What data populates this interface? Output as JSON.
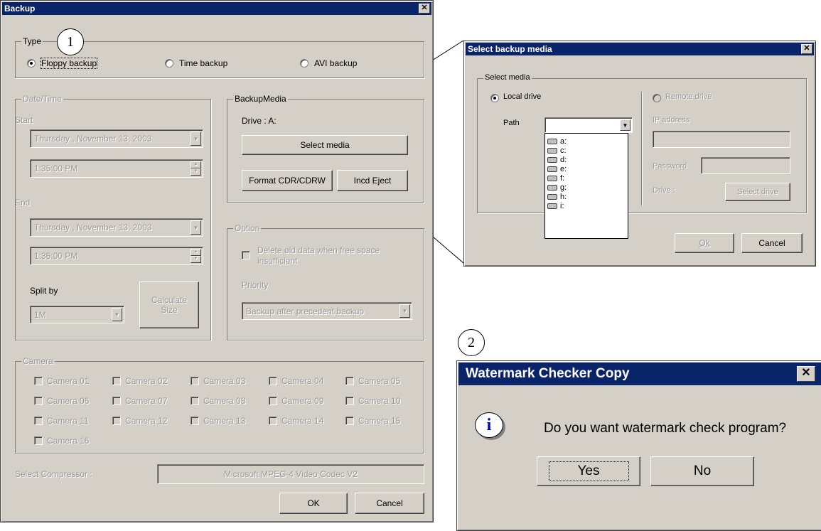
{
  "backup": {
    "title": "Backup",
    "type_group": "Type",
    "type_options": [
      "Floppy backup",
      "Time backup",
      "AVI backup"
    ],
    "datetime_group": "Date/Time",
    "start_label": "Start",
    "start_date": "Thursday   , November 13, 2003",
    "start_time": "1:35:00 PM",
    "end_label": "End",
    "end_date": "Thursday   , November 13, 2003",
    "end_time": "1:36:00 PM",
    "split_label": "Split by",
    "split_value": "1M",
    "calculate_label_1": "Calculate",
    "calculate_label_2": "Size",
    "media_group": "BackupMedia",
    "drive_label": "Drive : A:",
    "select_media": "Select media",
    "format_button": "Format CDR/CDRW",
    "eject_button": "Incd Eject",
    "option_group": "Option",
    "delete_old_1": "Delete old data when free space",
    "delete_old_2": "insufficient",
    "priority_label": "Priority",
    "priority_value": "Backup after precedent backup",
    "camera_group": "Camera",
    "cameras": [
      "Camera 01",
      "Camera 02",
      "Camera 03",
      "Camera 04",
      "Camera 05",
      "Camera 06",
      "Camera 07",
      "Camera 08",
      "Camera 09",
      "Camera 10",
      "Camera 11",
      "Camera 12",
      "Camera 13",
      "Camera 14",
      "Camera 15",
      "Camera 16"
    ],
    "compressor_label": "Select Compressor :",
    "compressor_value": "Microsoft MPEG-4 Video Codec V2",
    "ok": "OK",
    "cancel": "Cancel"
  },
  "media_dialog": {
    "title": "Select backup media",
    "group": "Select media",
    "local": "Local drive",
    "remote": "Remote drive",
    "path_label": "Path",
    "drives": [
      "a:",
      "c:",
      "d:",
      "e:",
      "f:",
      "g:",
      "h:",
      "i:"
    ],
    "ip_label": "IP address",
    "password_label": "Password",
    "drive_label": "Drive :",
    "select_drive": "Select drive",
    "ok": "Ok",
    "cancel": "Cancel"
  },
  "watermark": {
    "title": "Watermark Checker Copy",
    "message": "Do you want watermark check program?",
    "yes": "Yes",
    "no": "No"
  },
  "callouts": [
    "1",
    "2"
  ]
}
